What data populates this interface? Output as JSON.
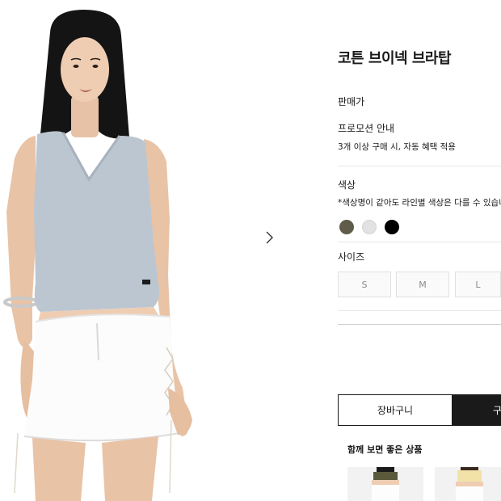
{
  "gallery": {
    "next_arrow_icon": "chevron-right-icon"
  },
  "product": {
    "name": "코튼 브이넥 브라탑",
    "price_label": "판매가"
  },
  "promotion": {
    "label": "프로모션 안내",
    "text": "3개 이상 구매 시, 자동 혜택 적용"
  },
  "color": {
    "label": "색상",
    "note": "*색상명이 같아도 라인별 색상은 다를 수 있습니다",
    "swatches": [
      {
        "name": "khaki",
        "hex": "#5f5c49"
      },
      {
        "name": "light-gray",
        "hex": "#e2e2e2"
      },
      {
        "name": "black",
        "hex": "#000000"
      }
    ]
  },
  "size": {
    "label": "사이즈",
    "options": [
      "S",
      "M",
      "L"
    ]
  },
  "actions": {
    "cart_label": "장바구니",
    "buy_label": "구"
  },
  "recommendations": {
    "label": "함께 보면 좋은 상품",
    "items": [
      {
        "top_color": "#5a5a3a"
      },
      {
        "top_color": "#f2e2a8"
      }
    ]
  },
  "colors": {
    "text": "#1a1a1a",
    "divider": "#e7e7e7",
    "button_dark": "#1a1a1a"
  }
}
